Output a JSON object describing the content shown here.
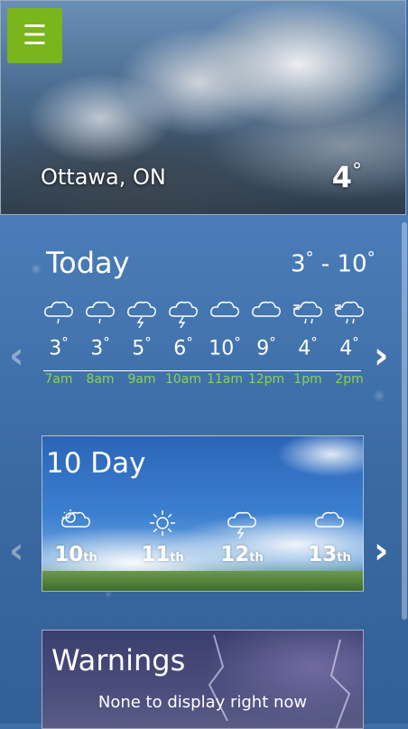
{
  "menu": {
    "icon": "hamburger-icon",
    "glyph": "☰",
    "color": "#7ab51d"
  },
  "current": {
    "city": "Ottawa, ON",
    "temp": "4",
    "degree": "°"
  },
  "today": {
    "title": "Today",
    "low": "3",
    "high": "10",
    "sep": " - ",
    "degree": "°",
    "hours": [
      {
        "icon": "rain-cloud-icon",
        "temp": "3",
        "time": "7am"
      },
      {
        "icon": "rain-cloud-icon",
        "temp": "3",
        "time": "8am"
      },
      {
        "icon": "thunder-cloud-icon",
        "temp": "5",
        "time": "9am"
      },
      {
        "icon": "thunder-cloud-icon",
        "temp": "6",
        "time": "10am"
      },
      {
        "icon": "cloud-icon",
        "temp": "10",
        "time": "11am"
      },
      {
        "icon": "cloud-icon",
        "temp": "9",
        "time": "12pm"
      },
      {
        "icon": "windy-rain-icon",
        "temp": "4",
        "time": "1pm"
      },
      {
        "icon": "windy-rain-icon",
        "temp": "4",
        "time": "2pm"
      }
    ]
  },
  "tenday": {
    "title": "10 Day",
    "days": [
      {
        "icon": "partly-sunny-icon",
        "num": "10",
        "suffix": "th"
      },
      {
        "icon": "sun-icon",
        "num": "11",
        "suffix": "th"
      },
      {
        "icon": "thunder-cloud-icon",
        "num": "12",
        "suffix": "th"
      },
      {
        "icon": "cloud-icon",
        "num": "13",
        "suffix": "th"
      }
    ]
  },
  "warnings": {
    "title": "Warnings",
    "text": "None to display right now"
  },
  "colors": {
    "time_label": "#8fd14f",
    "accent": "#7ab51d"
  }
}
